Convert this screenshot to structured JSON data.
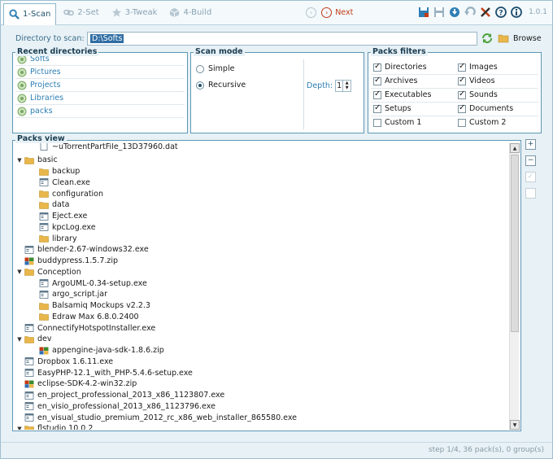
{
  "toolbar": {
    "tabs": [
      {
        "label": "1-Scan",
        "active": true
      },
      {
        "label": "2-Set",
        "active": false
      },
      {
        "label": "3-Tweak",
        "active": false
      },
      {
        "label": "4-Build",
        "active": false
      }
    ],
    "next_label": "Next",
    "version": "1.0.1",
    "tool_icons": [
      "save-as-icon",
      "save-icon",
      "download-icon",
      "undo-icon",
      "tools-icon",
      "help-icon",
      "info-icon"
    ]
  },
  "directory": {
    "label": "Directory to scan:",
    "value": "D:\\Softs",
    "browse_label": "Browse"
  },
  "recent": {
    "title": "Recent directories",
    "items": [
      "Softs",
      "Pictures",
      "Projects",
      "Libraries",
      "packs"
    ]
  },
  "scan_mode": {
    "title": "Scan mode",
    "options": [
      "Simple",
      "Recursive"
    ],
    "selected": "Recursive",
    "depth_label": "Depth:",
    "depth_value": "1"
  },
  "filters": {
    "title": "Packs filters",
    "items": [
      {
        "label": "Directories",
        "checked": true
      },
      {
        "label": "Images",
        "checked": true
      },
      {
        "label": "Archives",
        "checked": true
      },
      {
        "label": "Videos",
        "checked": true
      },
      {
        "label": "Executables",
        "checked": true
      },
      {
        "label": "Sounds",
        "checked": true
      },
      {
        "label": "Setups",
        "checked": true
      },
      {
        "label": "Documents",
        "checked": true
      },
      {
        "label": "Custom 1",
        "checked": false
      },
      {
        "label": "Custom 2",
        "checked": false
      }
    ]
  },
  "packs_view": {
    "title": "Packs view",
    "rows": [
      {
        "label": "~uTorrentPartFile_13D37960.dat",
        "indent": 2,
        "type": "file",
        "toggle": ""
      },
      {
        "label": "basic",
        "indent": 1,
        "type": "folder",
        "toggle": "▼"
      },
      {
        "label": "backup",
        "indent": 2,
        "type": "folder",
        "toggle": ""
      },
      {
        "label": "Clean.exe",
        "indent": 2,
        "type": "exe",
        "toggle": ""
      },
      {
        "label": "configuration",
        "indent": 2,
        "type": "folder",
        "toggle": ""
      },
      {
        "label": "data",
        "indent": 2,
        "type": "folder",
        "toggle": ""
      },
      {
        "label": "Eject.exe",
        "indent": 2,
        "type": "exe",
        "toggle": ""
      },
      {
        "label": "kpcLog.exe",
        "indent": 2,
        "type": "exe",
        "toggle": ""
      },
      {
        "label": "library",
        "indent": 2,
        "type": "folder",
        "toggle": ""
      },
      {
        "label": "blender-2.67-windows32.exe",
        "indent": 1,
        "type": "exe",
        "toggle": ""
      },
      {
        "label": "buddypress.1.5.7.zip",
        "indent": 1,
        "type": "zip",
        "toggle": ""
      },
      {
        "label": "Conception",
        "indent": 1,
        "type": "folder",
        "toggle": "▼"
      },
      {
        "label": "ArgoUML-0.34-setup.exe",
        "indent": 2,
        "type": "exe",
        "toggle": ""
      },
      {
        "label": "argo_script.jar",
        "indent": 2,
        "type": "exe",
        "toggle": ""
      },
      {
        "label": "Balsamiq Mockups v2.2.3",
        "indent": 2,
        "type": "folder",
        "toggle": ""
      },
      {
        "label": "Edraw Max 6.8.0.2400",
        "indent": 2,
        "type": "folder",
        "toggle": ""
      },
      {
        "label": "ConnectifyHotspotInstaller.exe",
        "indent": 1,
        "type": "exe",
        "toggle": ""
      },
      {
        "label": "dev",
        "indent": 1,
        "type": "folder",
        "toggle": "▼"
      },
      {
        "label": "appengine-java-sdk-1.8.6.zip",
        "indent": 2,
        "type": "zip",
        "toggle": ""
      },
      {
        "label": "Dropbox 1.6.11.exe",
        "indent": 1,
        "type": "exe",
        "toggle": ""
      },
      {
        "label": "EasyPHP-12.1_with_PHP-5.4.6-setup.exe",
        "indent": 1,
        "type": "exe",
        "toggle": ""
      },
      {
        "label": "eclipse-SDK-4.2-win32.zip",
        "indent": 1,
        "type": "zip",
        "toggle": ""
      },
      {
        "label": "en_project_professional_2013_x86_1123807.exe",
        "indent": 1,
        "type": "exe",
        "toggle": ""
      },
      {
        "label": "en_visio_professional_2013_x86_1123796.exe",
        "indent": 1,
        "type": "exe",
        "toggle": ""
      },
      {
        "label": "en_visual_studio_premium_2012_rc_x86_web_installer_865580.exe",
        "indent": 1,
        "type": "exe",
        "toggle": ""
      },
      {
        "label": "flstudio 10.0.2",
        "indent": 1,
        "type": "folder",
        "toggle": "▼"
      }
    ]
  },
  "status": {
    "text": "step 1/4, 36 pack(s), 0 group(s)"
  },
  "colors": {
    "accent": "#2d7fb4",
    "folder": "#e8b64a",
    "next": "#c23c16"
  }
}
